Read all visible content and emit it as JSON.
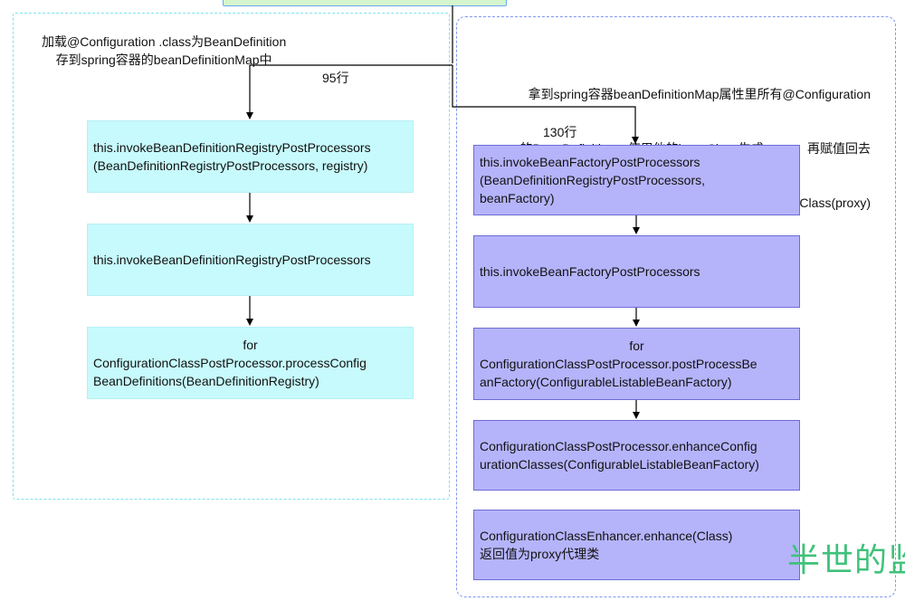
{
  "diagram": {
    "left_group": {
      "note_lines": [
        "加载@Configuration .class为BeanDefinition",
        "存到spring容器的beanDefinitionMap中"
      ],
      "line_label": "95行",
      "boxes": [
        {
          "lines": [
            "this.invokeBeanDefinitionRegistryPostProcessors",
            "(BeanDefinitionRegistryPostProcessors, registry)"
          ]
        },
        {
          "lines": [
            "this.invokeBeanDefinitionRegistryPostProcessors"
          ]
        },
        {
          "first_line": "for",
          "lines": [
            "ConfigurationClassPostProcessor.processConfig",
            "BeanDefinitions(BeanDefinitionRegistry)"
          ]
        }
      ]
    },
    "right_group": {
      "note_lines": [
        "拿到spring容器beanDefinitionMap属性里所有@Configuration",
        "的BeanDefinition，使用他的beanClass生成proxy，再赋值回去",
        "BeanDefinition.setBeanClass(proxy)"
      ],
      "line_label": "130行",
      "boxes": [
        {
          "lines": [
            "this.invokeBeanFactoryPostProcessors",
            "(BeanDefinitionRegistryPostProcessors,",
            "beanFactory)"
          ]
        },
        {
          "lines": [
            "this.invokeBeanFactoryPostProcessors"
          ]
        },
        {
          "first_line": "for",
          "lines": [
            "ConfigurationClassPostProcessor.postProcessBe",
            "anFactory(ConfigurableListableBeanFactory)"
          ]
        },
        {
          "lines": [
            "ConfigurationClassPostProcessor.enhanceConfig",
            "urationClasses(ConfigurableListableBeanFactory)"
          ]
        },
        {
          "lines": [
            "ConfigurationClassEnhancer.enhance(Class)",
            "返回值为proxy代理类"
          ]
        }
      ]
    },
    "watermark": "半世的监",
    "colors": {
      "cyan_box_fill": "#c7fafc",
      "blue_box_fill": "#b5b4fb",
      "blue_box_stroke": "#6d6cd9",
      "left_group_border": "#7fe3ec",
      "right_group_border": "#7f97f0",
      "top_box_fill": "#d5f5cf",
      "watermark": "#3fc27a"
    }
  }
}
